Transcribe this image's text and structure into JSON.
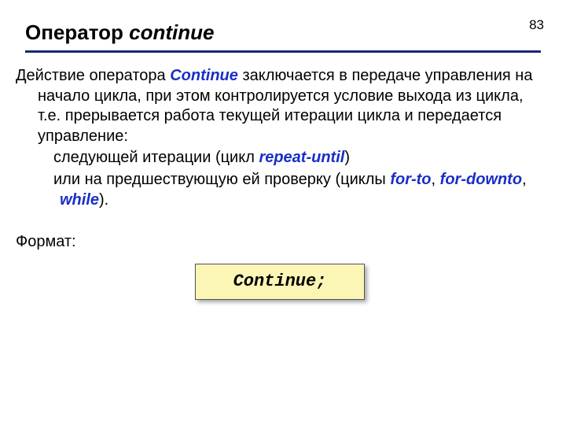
{
  "page_number": "83",
  "title": {
    "prefix": "Оператор ",
    "operator": "continue"
  },
  "intro": {
    "part1": "Действие оператора  ",
    "kw": "Continue",
    "part2": " заключается в передаче управления на начало цикла,  при этом контролируется условие выхода из цикла, т.е. прерывается работа текущей итерации цикла и передается управление:"
  },
  "bullets": [
    {
      "prefix": "следующей итерации (цикл ",
      "kw1": "repeat-until",
      "suffix": ")"
    },
    {
      "prefix": "или на предшествующую ей проверку (циклы ",
      "kw1": "for-to",
      "sep1": ", ",
      "kw2": "for-downto",
      "sep2": ", ",
      "kw3": "while",
      "suffix": ")."
    }
  ],
  "format_label": "Формат:",
  "code": "Continue;",
  "bullet_glyph": ""
}
